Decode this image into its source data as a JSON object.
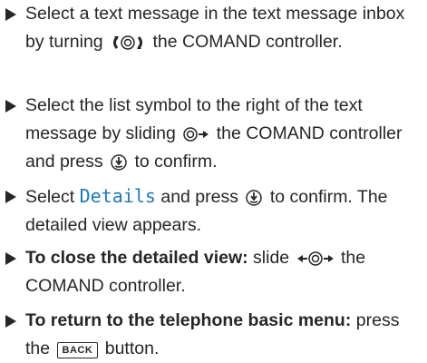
{
  "steps": [
    {
      "t1": "Select a text message in the text message inbox by turning",
      "t2": "the COMAND controller."
    },
    {
      "t1": "Select the list symbol to the right of the text message by sliding",
      "t2": "the COMAND controller and press",
      "t3": "to confirm."
    },
    {
      "t1": "Select",
      "highlight": "Details",
      "t2": "and press",
      "t3": "to confirm. The detailed view appears."
    },
    {
      "bold": "To close the detailed view:",
      "t1": "slide",
      "t2": "the COMAND controller."
    },
    {
      "bold": "To return to the telephone basic menu:",
      "t1": "press the",
      "button": "BACK",
      "t2": "button."
    }
  ],
  "colors": {
    "text": "#262626",
    "accent": "#1c78c0"
  },
  "icons": {
    "turn": "rotate-controller-icon",
    "slide_right": "slide-right-icon",
    "slide_both": "slide-left-right-icon",
    "press": "press-controller-icon"
  }
}
